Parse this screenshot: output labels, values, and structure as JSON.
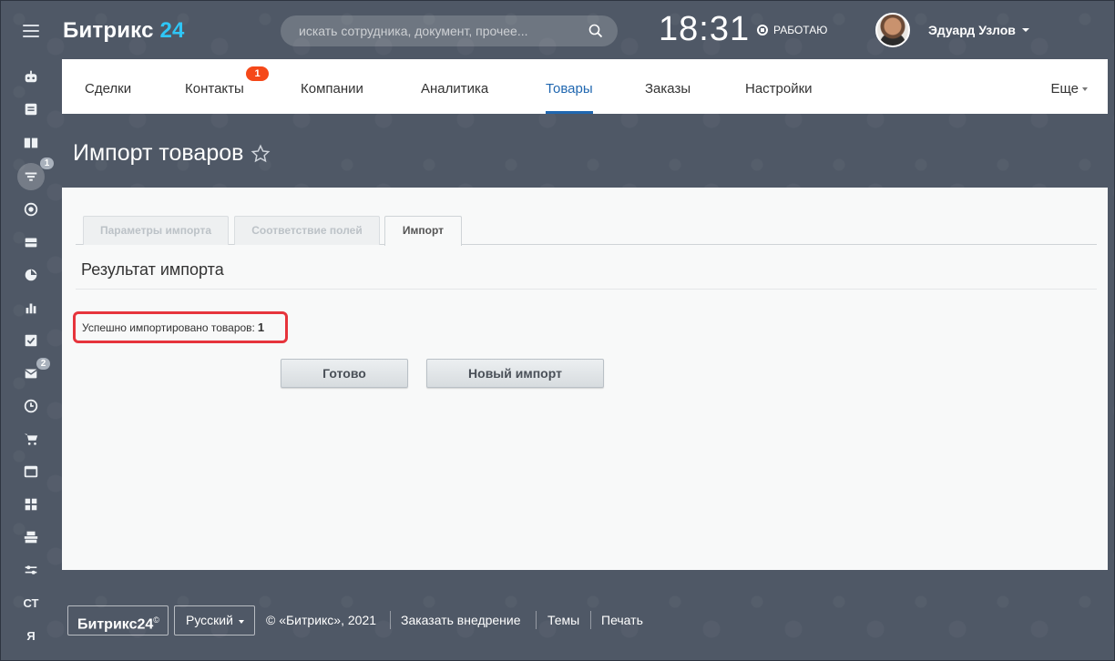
{
  "header": {
    "logo_text": "Битрикс",
    "logo_num": "24",
    "search_placeholder": "искать сотрудника, документ, прочее...",
    "clock": "18:31",
    "work_status": "РАБОТАЮ",
    "user_name": "Эдуард Узлов"
  },
  "sidebar": {
    "funnel_badge": "1",
    "mail_badge": "2",
    "text_items": [
      "СТ",
      "Я"
    ]
  },
  "nav": {
    "items": [
      {
        "label": "Сделки"
      },
      {
        "label": "Контакты",
        "counter": "1"
      },
      {
        "label": "Компании"
      },
      {
        "label": "Аналитика"
      },
      {
        "label": "Товары"
      },
      {
        "label": "Заказы"
      },
      {
        "label": "Настройки"
      }
    ],
    "more": "Еще"
  },
  "page": {
    "title": "Импорт товаров"
  },
  "wizard": {
    "tabs": [
      "Параметры импорта",
      "Соответствие полей",
      "Импорт"
    ],
    "section_title": "Результат импорта",
    "result_label": "Успешно импортировано товаров:",
    "result_count": "1",
    "done_button": "Готово",
    "new_import_button": "Новый импорт"
  },
  "footer": {
    "logo": "Битрикс24",
    "logo_mark": "©",
    "language": "Русский",
    "copyright": "© «Битрикс», 2021",
    "links": [
      "Заказать внедрение",
      "Темы",
      "Печать"
    ]
  },
  "colors": {
    "accent": "#2067b0",
    "logo_num": "#2fc6f6",
    "counter": "#f54819",
    "highlight": "#e6343c"
  }
}
